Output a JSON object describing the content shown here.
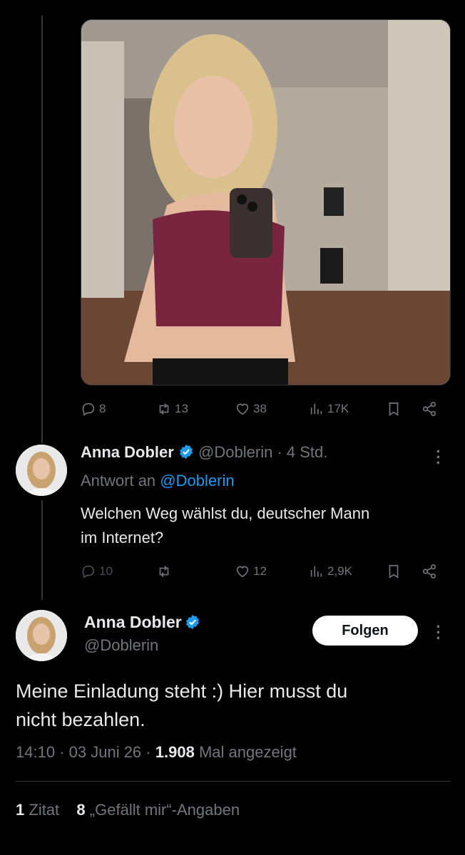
{
  "first_tweet": {
    "stats": {
      "replies": "8",
      "retweets": "13",
      "likes": "38",
      "views": "17K"
    }
  },
  "reply_tweet": {
    "author_name": "Anna Dobler",
    "handle": "@Doblerin",
    "separator": "·",
    "time": "4 Std.",
    "reply_prefix": "Antwort an",
    "reply_to": "@Doblerin",
    "text_line1": "Welchen Weg wählst du, deutscher Mann",
    "text_line2": "im Internet?",
    "stats": {
      "replies": "10",
      "retweets": "",
      "likes": "12",
      "views": "2,9K"
    }
  },
  "main_tweet": {
    "author_name": "Anna Dobler",
    "handle": "@Doblerin",
    "follow_label": "Folgen",
    "text_line1": "Meine Einladung steht :) Hier musst du",
    "text_line2": "nicht bezahlen.",
    "time": "14:10",
    "date": "03 Juni 26",
    "view_count": "1.908",
    "view_label": "Mal angezeigt",
    "quote_count": "1",
    "quote_label": "Zitat",
    "like_count": "8",
    "like_label": "„Gefällt mir“-Angaben"
  },
  "colors": {
    "background": "#000000",
    "text": "#e7e9ea",
    "muted": "#71767b",
    "link": "#1d9bf0",
    "verified": "#1d9bf0"
  }
}
